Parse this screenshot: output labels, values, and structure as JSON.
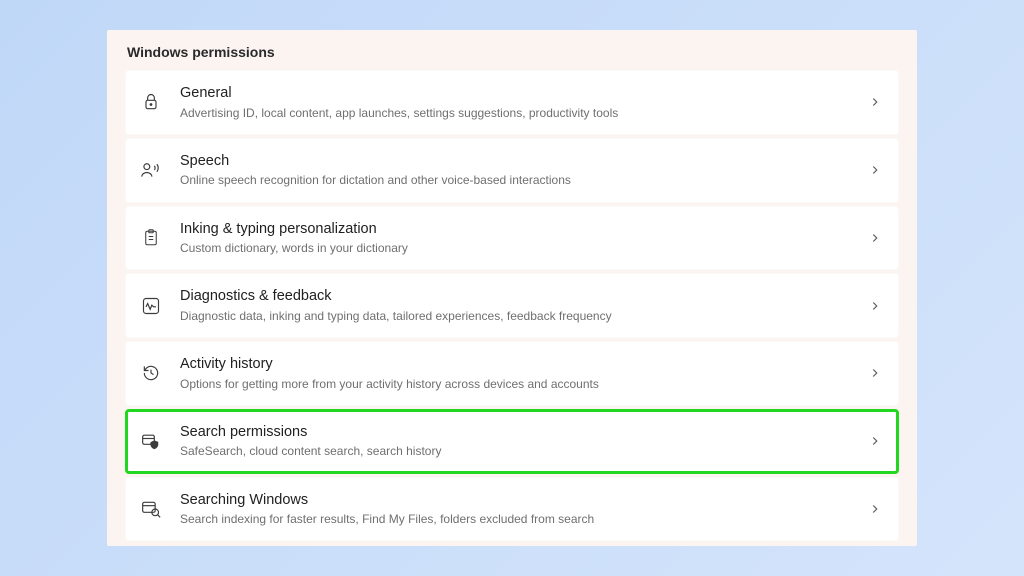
{
  "section_title": "Windows permissions",
  "items": [
    {
      "title": "General",
      "desc": "Advertising ID, local content, app launches, settings suggestions, productivity tools",
      "highlighted": false,
      "icon": "lock"
    },
    {
      "title": "Speech",
      "desc": "Online speech recognition for dictation and other voice-based interactions",
      "highlighted": false,
      "icon": "speech"
    },
    {
      "title": "Inking & typing personalization",
      "desc": "Custom dictionary, words in your dictionary",
      "highlighted": false,
      "icon": "clipboard"
    },
    {
      "title": "Diagnostics & feedback",
      "desc": "Diagnostic data, inking and typing data, tailored experiences, feedback frequency",
      "highlighted": false,
      "icon": "diagnostics"
    },
    {
      "title": "Activity history",
      "desc": "Options for getting more from your activity history across devices and accounts",
      "highlighted": false,
      "icon": "history"
    },
    {
      "title": "Search permissions",
      "desc": "SafeSearch, cloud content search, search history",
      "highlighted": true,
      "icon": "search-shield"
    },
    {
      "title": "Searching Windows",
      "desc": "Search indexing for faster results, Find My Files, folders excluded from search",
      "highlighted": false,
      "icon": "search-windows"
    }
  ]
}
